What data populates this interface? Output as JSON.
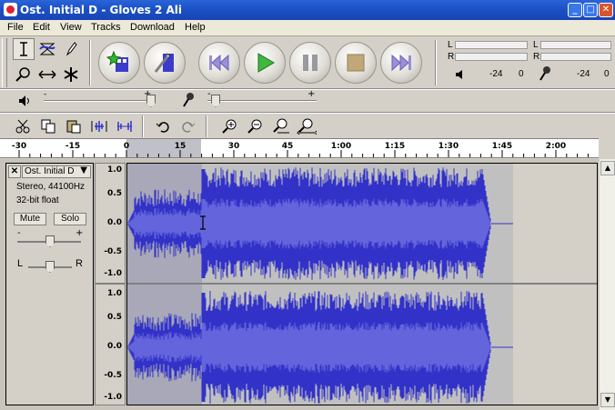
{
  "window": {
    "title": "Ost. Initial D - Gloves 2 Ali"
  },
  "menu": [
    "File",
    "Edit",
    "View",
    "Tracks",
    "Download",
    "Help"
  ],
  "meters": {
    "left_l": "L",
    "left_r": "R",
    "right_l": "L",
    "right_r": "R",
    "scale_a1": "-24",
    "scale_a2": "0",
    "scale_b1": "-24",
    "scale_b2": "0"
  },
  "mixer": {
    "plus1": "+",
    "minus2": "-",
    "plus2": "+"
  },
  "ruler": {
    "ticks": [
      "-30",
      "-15",
      "0",
      "15",
      "30",
      "45",
      "1:00",
      "1:15",
      "1:30",
      "1:45",
      "2:00"
    ]
  },
  "track": {
    "name": "Ost. Initial D",
    "info1": "Stereo, 44100Hz",
    "info2": "32-bit float",
    "mute": "Mute",
    "solo": "Solo",
    "gain_minus": "-",
    "gain_plus": "+",
    "pan_l": "L",
    "pan_r": "R"
  },
  "scale": {
    "labels": [
      "1.0",
      "0.5",
      "0.0",
      "-0.5",
      "-1.0"
    ]
  },
  "colors": {
    "wave": "#3232c8",
    "wave_rms": "#6464dc",
    "selection": "#a8a8b8",
    "bg_track": "#c0c0c0"
  }
}
